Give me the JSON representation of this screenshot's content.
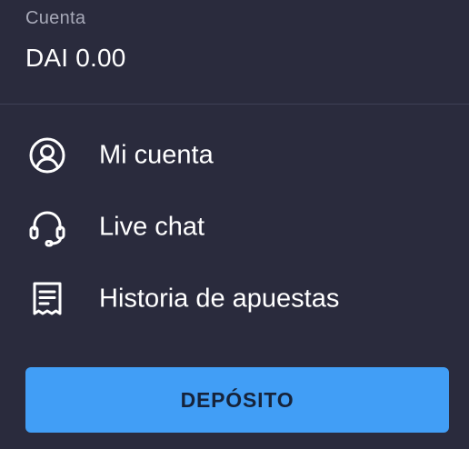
{
  "account": {
    "label": "Cuenta",
    "balance": "DAI 0.00"
  },
  "menu": {
    "items": [
      {
        "label": "Mi cuenta",
        "icon": "user-circle-icon"
      },
      {
        "label": "Live chat",
        "icon": "headset-icon"
      },
      {
        "label": "Historia de apuestas",
        "icon": "receipt-icon"
      }
    ]
  },
  "actions": {
    "deposit_label": "DEPÓSITO"
  },
  "colors": {
    "background": "#2a2b3d",
    "accent": "#419ef6",
    "text_primary": "#ffffff",
    "text_secondary": "#a7a9b8"
  }
}
